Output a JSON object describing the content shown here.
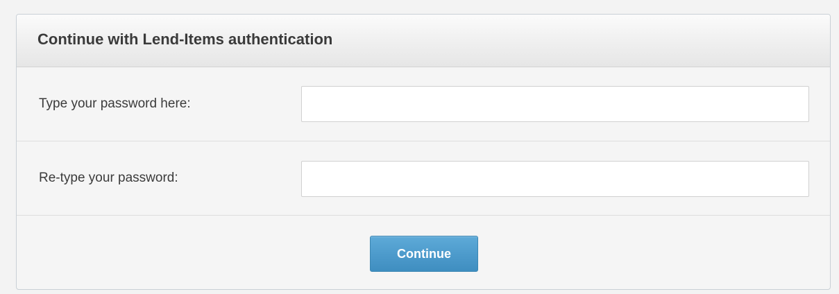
{
  "panel": {
    "title": "Continue with Lend-Items authentication"
  },
  "form": {
    "password": {
      "label": "Type your password here:",
      "value": "",
      "placeholder": ""
    },
    "retype": {
      "label": "Re-type your password:",
      "value": "",
      "placeholder": ""
    },
    "continue_label": "Continue"
  },
  "colors": {
    "accent": "#4c9acb",
    "background": "#f5f5f5",
    "text": "#3a3a3a"
  }
}
